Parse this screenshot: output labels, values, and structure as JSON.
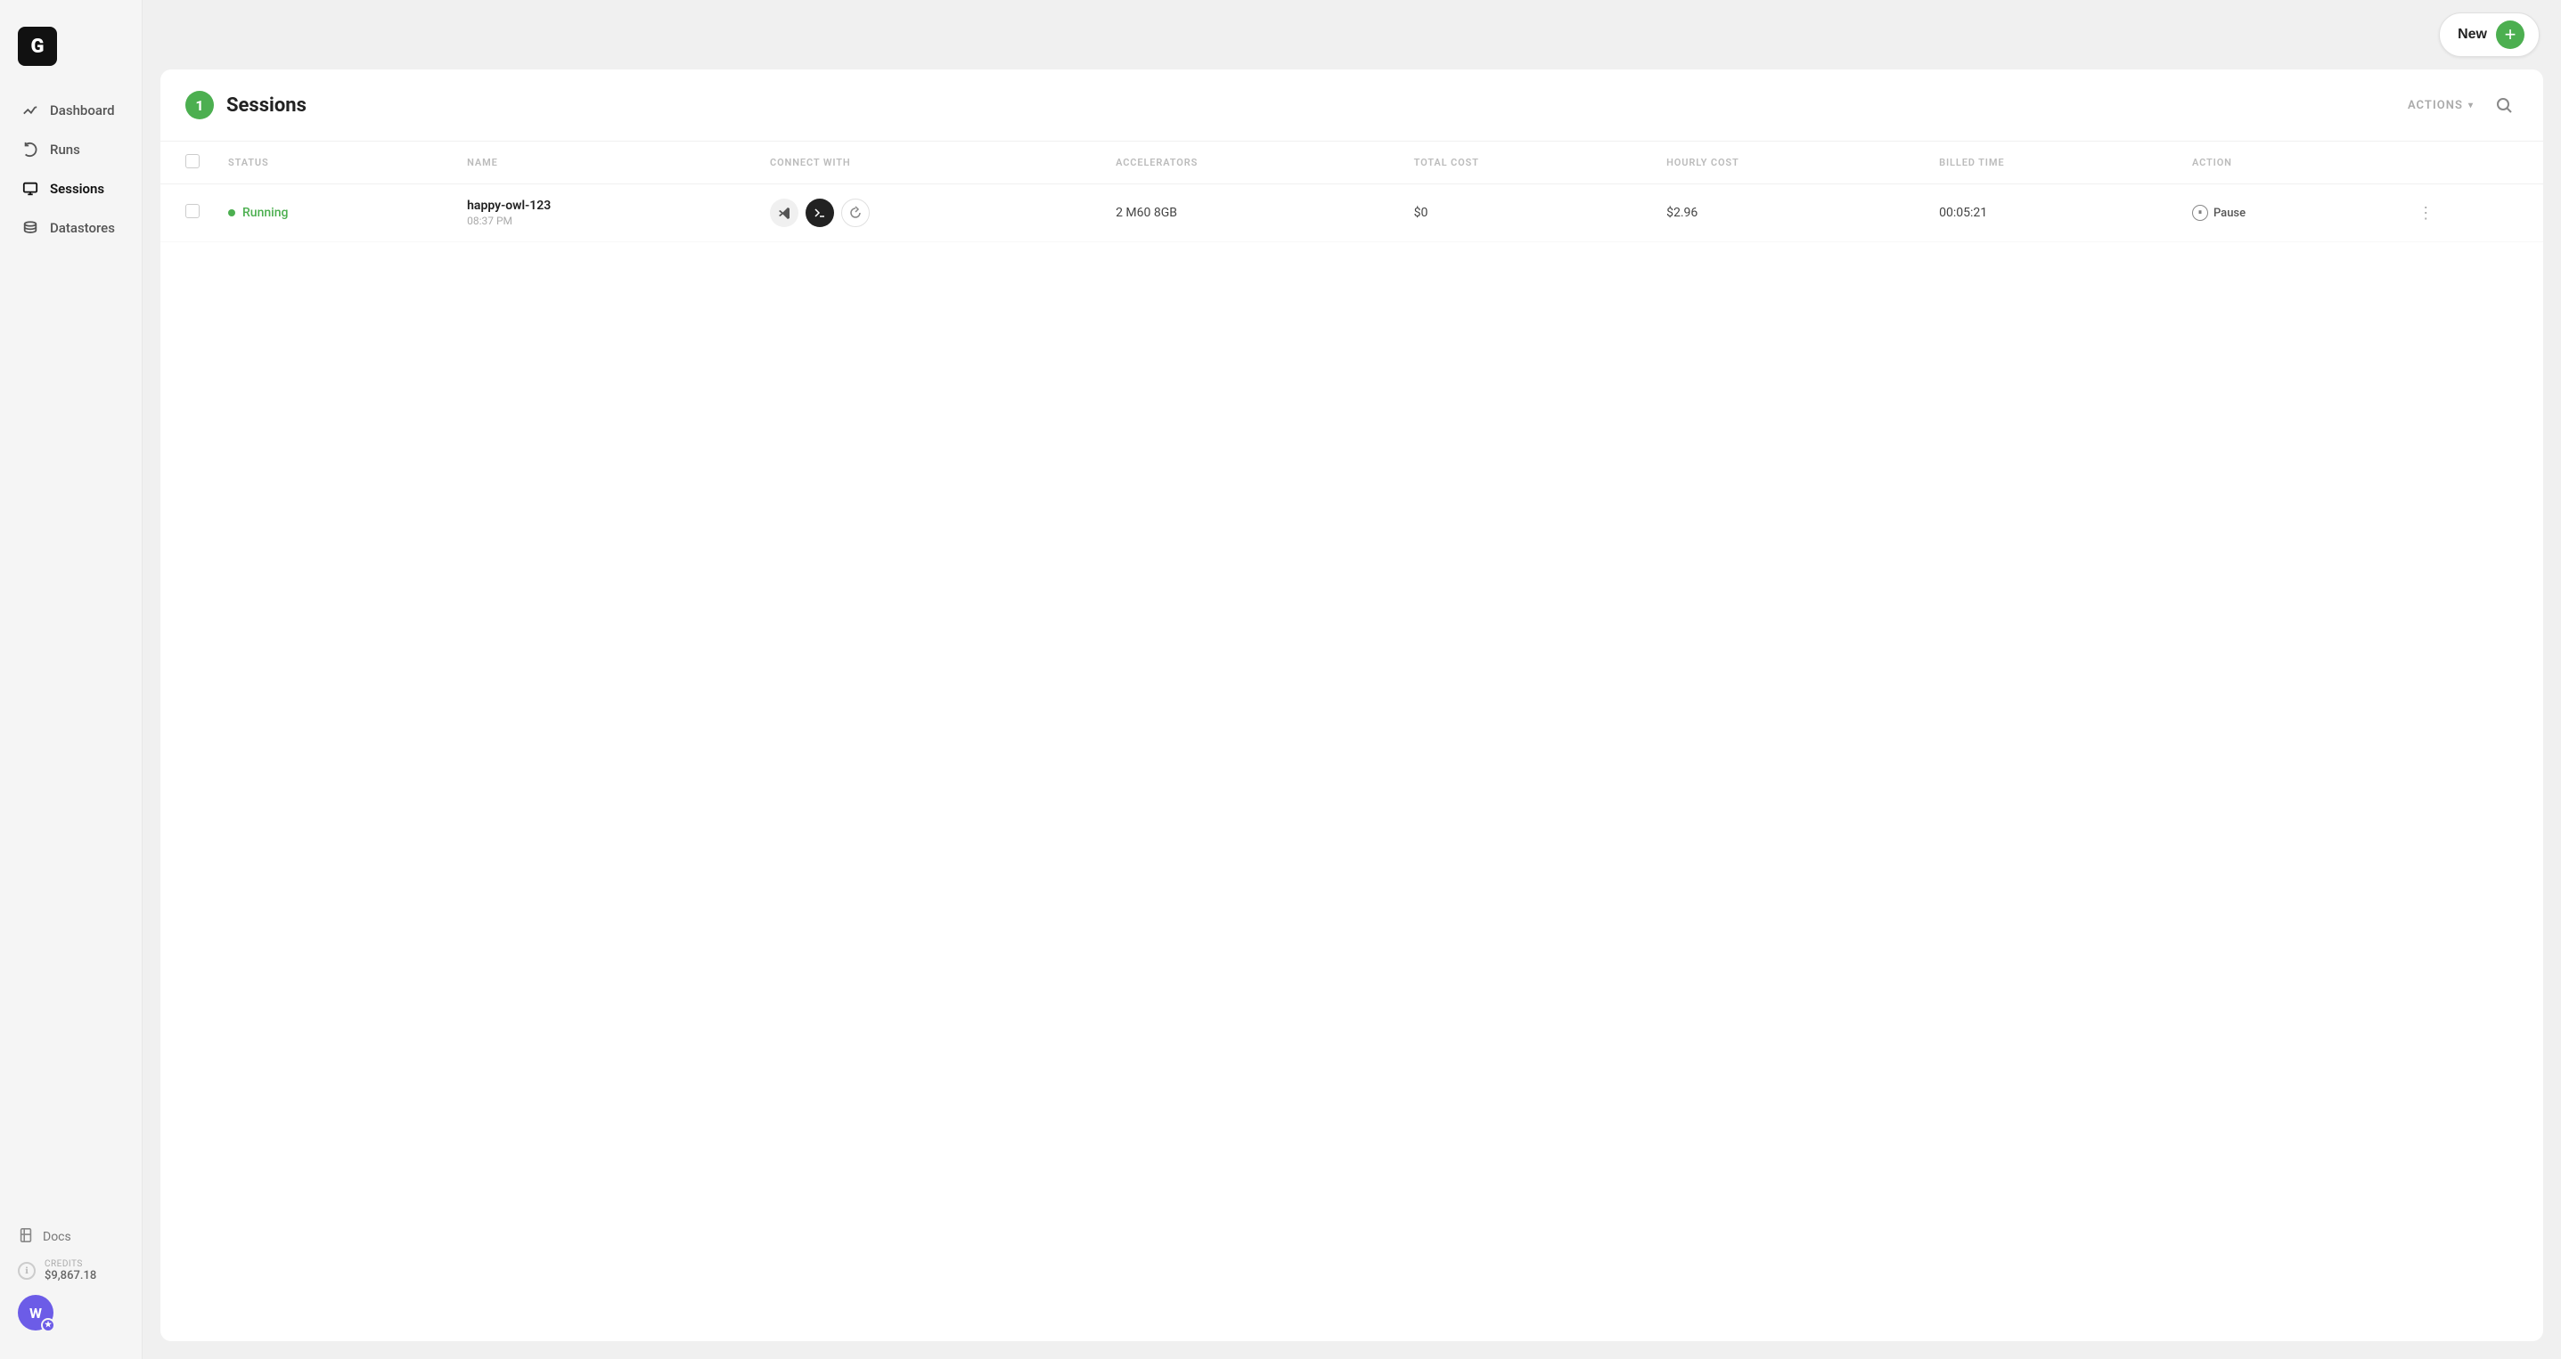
{
  "sidebar": {
    "logo": "G",
    "nav_items": [
      {
        "id": "dashboard",
        "label": "Dashboard",
        "icon": "chart-icon",
        "active": false
      },
      {
        "id": "runs",
        "label": "Runs",
        "icon": "refresh-icon",
        "active": false
      },
      {
        "id": "sessions",
        "label": "Sessions",
        "icon": "monitor-icon",
        "active": true
      },
      {
        "id": "datastores",
        "label": "Datastores",
        "icon": "database-icon",
        "active": false
      }
    ],
    "docs": {
      "label": "Docs",
      "icon": "doc-icon"
    },
    "credits": {
      "label": "CREDITS",
      "value": "$9,867.18"
    },
    "user": {
      "initials": "W",
      "star": "★"
    }
  },
  "topbar": {
    "new_button_label": "New"
  },
  "panel": {
    "count": "1",
    "title": "Sessions",
    "actions_label": "ACTIONS",
    "table": {
      "columns": [
        {
          "id": "status",
          "label": "STATUS"
        },
        {
          "id": "name",
          "label": "NAME"
        },
        {
          "id": "connect_with",
          "label": "CONNECT WITH"
        },
        {
          "id": "accelerators",
          "label": "ACCELERATORS"
        },
        {
          "id": "total_cost",
          "label": "TOTAL COST"
        },
        {
          "id": "hourly_cost",
          "label": "HOURLY COST"
        },
        {
          "id": "billed_time",
          "label": "BILLED TIME"
        },
        {
          "id": "action",
          "label": "ACTION"
        }
      ],
      "rows": [
        {
          "status": "Running",
          "name": "happy-owl-123",
          "time": "08:37 PM",
          "accelerators": "2 M60 8GB",
          "total_cost": "$0",
          "hourly_cost": "$2.96",
          "billed_time": "00:05:21",
          "action_label": "Pause"
        }
      ]
    }
  }
}
